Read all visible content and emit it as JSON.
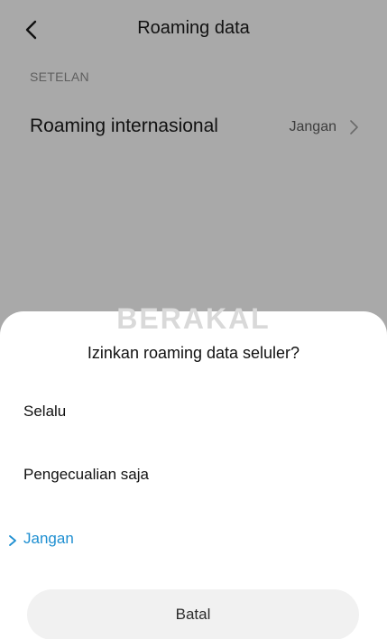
{
  "header": {
    "title": "Roaming data",
    "back_icon": "chevron-left-icon"
  },
  "settings": {
    "section_label": "SETELAN",
    "roaming_row": {
      "title": "Roaming internasional",
      "value": "Jangan",
      "icon": "chevron-right-icon"
    }
  },
  "dialog": {
    "watermark": "BERAKAL",
    "title": "Izinkan roaming data seluler?",
    "options": [
      {
        "label": "Selalu",
        "selected": false
      },
      {
        "label": "Pengecualian saja",
        "selected": false
      },
      {
        "label": "Jangan",
        "selected": true
      }
    ],
    "cancel_label": "Batal"
  },
  "colors": {
    "accent": "#1e8fd1",
    "dim_background": "#a9a9a9",
    "sheet_background": "#ffffff",
    "cancel_button": "#f1f1f1"
  }
}
